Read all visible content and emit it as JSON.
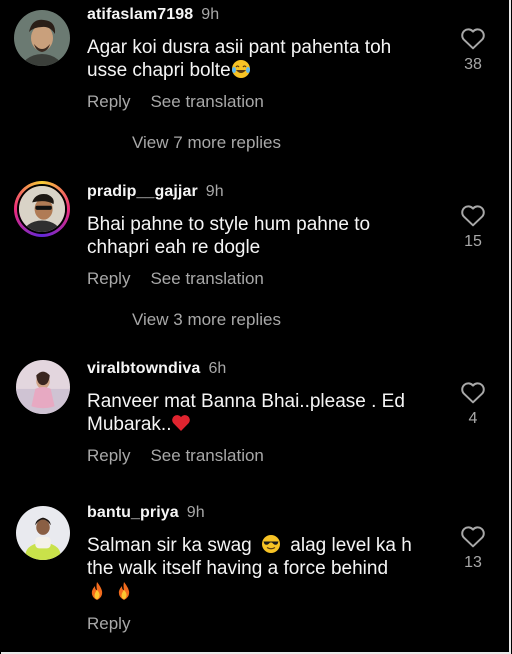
{
  "comments": [
    {
      "username": "atifaslam7198",
      "time": "9h",
      "text_line1": "Agar koi dusra asii pant pahenta toh",
      "text_line2": "usse chapri bolte",
      "emoji": "laughing-tears",
      "likes": "38",
      "reply_label": "Reply",
      "translate_label": "See translation",
      "view_more": "View 7 more replies"
    },
    {
      "username": "pradip__gajjar",
      "time": "9h",
      "text_line1": "Bhai pahne to style hum pahne to",
      "text_line2": "chhapri eah re dogle",
      "likes": "15",
      "reply_label": "Reply",
      "translate_label": "See translation",
      "view_more": "View 3 more replies"
    },
    {
      "username": "viralbtowndiva",
      "time": "6h",
      "text_line1": "Ranveer mat Banna Bhai..please . Ed",
      "text_line2": "Mubarak..",
      "emoji": "red-heart",
      "likes": "4",
      "reply_label": "Reply",
      "translate_label": "See translation"
    },
    {
      "username": "bantu_priya",
      "time": "9h",
      "text_line1a": "Salman sir ka swag",
      "text_line1b": "alag level ka h",
      "text_line2": "the walk itself having a force behind",
      "emoji_mid": "sunglasses",
      "emoji_end": "fire-fire",
      "likes": "13",
      "reply_label": "Reply"
    }
  ],
  "icons": {
    "like": "heart-outline-icon"
  },
  "colors": {
    "background": "#000000",
    "primary_text": "#f5f5f5",
    "secondary_text": "#a8a8a8"
  }
}
